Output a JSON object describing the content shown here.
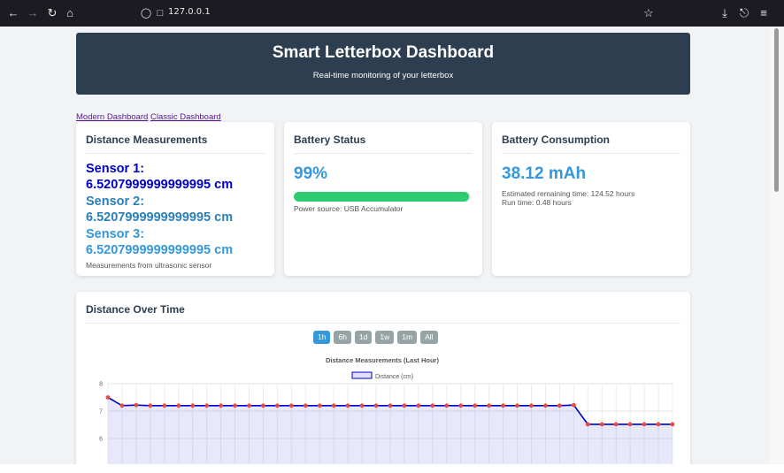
{
  "browser": {
    "url": "127.0.0.1"
  },
  "header": {
    "title": "Smart Letterbox Dashboard",
    "subtitle": "Real-time monitoring of your letterbox"
  },
  "nav": {
    "modern": "Modern Dashboard",
    "classic": "Classic Dashboard"
  },
  "distance_card": {
    "title": "Distance Measurements",
    "sensors": [
      {
        "label": "Sensor 1:",
        "value": "6.5207999999999995",
        "unit": "cm",
        "color": "#0000cc"
      },
      {
        "label": "Sensor 2:",
        "value": "6.5207999999999995",
        "unit": "cm",
        "color": "#2980b9"
      },
      {
        "label": "Sensor 3:",
        "value": "6.5207999999999995",
        "unit": "cm",
        "color": "#3498db"
      }
    ],
    "note": "Measurements from ultrasonic sensor"
  },
  "battery_card": {
    "title": "Battery Status",
    "percent": "99%",
    "level": 0.99,
    "source": "Power source: USB Accumulator"
  },
  "consumption_card": {
    "title": "Battery Consumption",
    "value": "38.12 mAh",
    "remaining": "Estimated remaining time: 124.52 hours",
    "runtime": "Run time: 0.48 hours"
  },
  "chart_card": {
    "title": "Distance Over Time",
    "ranges": [
      "1h",
      "6h",
      "1d",
      "1w",
      "1m",
      "All"
    ],
    "active_range": "1h"
  },
  "colors": {
    "header_bg": "#2c3e50",
    "accent": "#3498db",
    "battery_fill": "#2ecc71",
    "line": "#0000cc",
    "points": "#e74c3c"
  },
  "chart_data": {
    "type": "line",
    "title": "Distance Measurements (Last Hour)",
    "yticks": [
      "8",
      "7",
      "6"
    ],
    "ylim": [
      5,
      8
    ],
    "grid": true,
    "legend_placement": "top-center",
    "series": [
      {
        "name": "Distance (cm)",
        "values": [
          7.5,
          7.2,
          7.22,
          7.2,
          7.2,
          7.2,
          7.2,
          7.2,
          7.2,
          7.2,
          7.2,
          7.2,
          7.2,
          7.2,
          7.2,
          7.2,
          7.2,
          7.2,
          7.2,
          7.2,
          7.2,
          7.2,
          7.2,
          7.2,
          7.2,
          7.2,
          7.2,
          7.2,
          7.2,
          7.2,
          7.2,
          7.2,
          7.2,
          7.22,
          6.52,
          6.52,
          6.52,
          6.52,
          6.52,
          6.52,
          6.52
        ]
      }
    ]
  }
}
